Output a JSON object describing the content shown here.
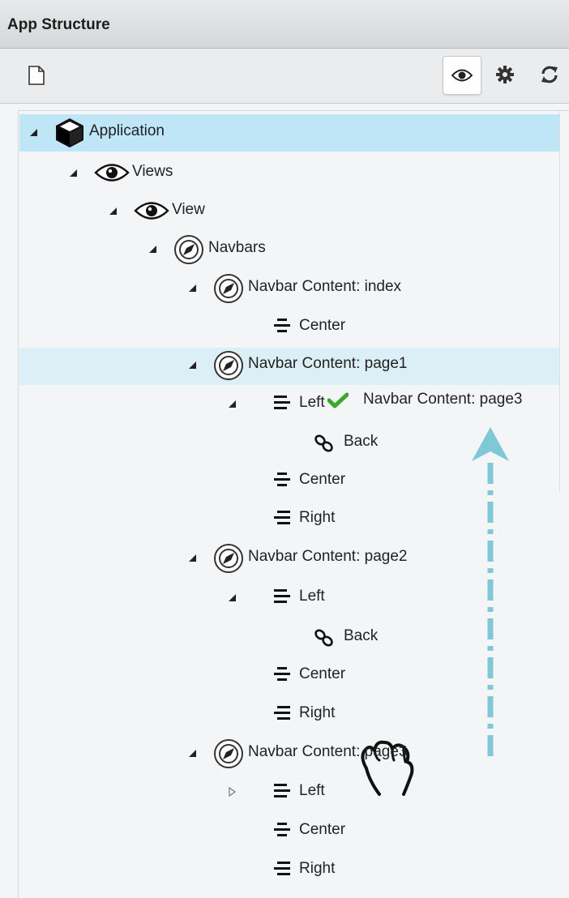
{
  "panel": {
    "title": "App Structure"
  },
  "toolbar": {
    "new_icon": "page-icon",
    "view_icon": "eye-icon",
    "settings_icon": "gear-icon",
    "refresh_icon": "refresh-icon"
  },
  "tree": {
    "nodes": [
      {
        "label": "Application",
        "icon": "cube-icon",
        "expanded": true,
        "selected": true
      },
      {
        "label": "Views",
        "icon": "eye-icon",
        "expanded": true
      },
      {
        "label": "View",
        "icon": "eye-icon",
        "expanded": true
      },
      {
        "label": "Navbars",
        "icon": "compass-icon",
        "expanded": true
      },
      {
        "label": "Navbar Content: index",
        "icon": "compass-icon",
        "expanded": true
      },
      {
        "label": "Center",
        "icon": "align-center-icon"
      },
      {
        "label": "Navbar Content: page1",
        "icon": "compass-icon",
        "expanded": true,
        "hovered": true
      },
      {
        "label": "Left",
        "icon": "align-left-icon",
        "expanded": true
      },
      {
        "label": "Back",
        "icon": "link-icon"
      },
      {
        "label": "Center",
        "icon": "align-center-icon"
      },
      {
        "label": "Right",
        "icon": "align-right-icon"
      },
      {
        "label": "Navbar Content: page2",
        "icon": "compass-icon",
        "expanded": true
      },
      {
        "label": "Left",
        "icon": "align-left-icon",
        "expanded": true
      },
      {
        "label": "Back",
        "icon": "link-icon"
      },
      {
        "label": "Center",
        "icon": "align-center-icon"
      },
      {
        "label": "Right",
        "icon": "align-right-icon"
      },
      {
        "label": "Navbar Content: page3",
        "icon": "compass-icon",
        "expanded": true
      },
      {
        "label": "Left",
        "icon": "align-left-icon",
        "expanded": false
      },
      {
        "label": "Center",
        "icon": "align-center-icon"
      },
      {
        "label": "Right",
        "icon": "align-right-icon"
      }
    ]
  },
  "drag": {
    "label": "Navbar Content: page3",
    "status_icon": "check-icon",
    "cursor_icon": "grab-hand-icon",
    "arrow_color": "#7ec8d8"
  },
  "colors": {
    "selected_row": "#bfe6f6",
    "hover_row": "#dceef6",
    "check_green": "#3aa829"
  }
}
